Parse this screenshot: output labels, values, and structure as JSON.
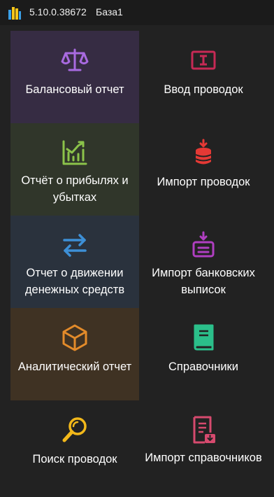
{
  "window": {
    "version": "5.10.0.38672",
    "database": "База1"
  },
  "colors": {
    "background": "#222222",
    "titlebar": "#1b1b1b",
    "balance_tile": "#362c43",
    "pnl_tile": "#30362a",
    "cashflow_tile": "#2a323d",
    "analytic_tile": "#3f3223"
  },
  "tiles": {
    "balance": {
      "label": "Балансовый отчет",
      "icon": "scales-icon"
    },
    "entry": {
      "label": "Ввод проводок",
      "icon": "text-input-icon"
    },
    "pnl": {
      "label": "Отчёт о прибылях и убытках",
      "icon": "chart-growth-icon"
    },
    "import_entries": {
      "label": "Импорт проводок",
      "icon": "database-import-icon"
    },
    "cashflow": {
      "label": "Отчет о движении денежных средств",
      "icon": "arrows-exchange-icon"
    },
    "import_bank": {
      "label": "Импорт банковских выписок",
      "icon": "tray-import-icon"
    },
    "analytic": {
      "label": "Аналитический отчет",
      "icon": "cube-icon"
    },
    "reference": {
      "label": "Справочники",
      "icon": "book-icon"
    },
    "search": {
      "label": "Поиск проводок",
      "icon": "magnifier-icon"
    },
    "import_reference": {
      "label": "Импорт справочников",
      "icon": "document-import-icon"
    }
  }
}
